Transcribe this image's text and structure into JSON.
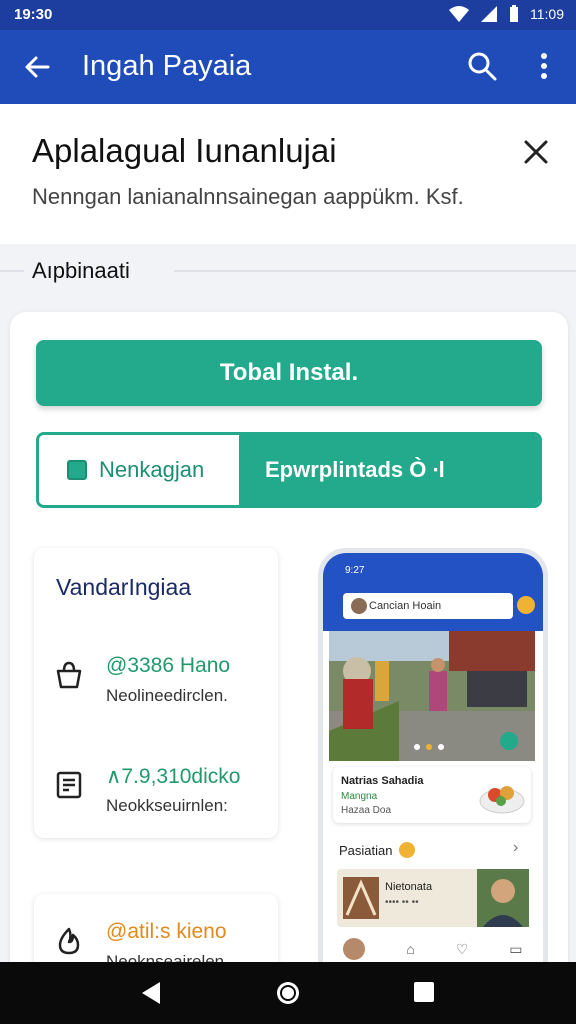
{
  "status_bar": {
    "time": "19:30",
    "right_time": "11:09"
  },
  "app_bar": {
    "title": "Ingah Payaia"
  },
  "sheet": {
    "heading": "Aplalagual Iunanlujai",
    "subtitle": "Nenngan lanianalnnsainegan aappükm. Ksf."
  },
  "section_label": "Aıpbinaati",
  "card": {
    "install_button": "Tobal Instal.",
    "segment": {
      "left_label": "Nenkagjan",
      "right_label": "Epwrplintads Ò ∙l"
    },
    "info": {
      "title": "VandarIngiaa",
      "rows": [
        {
          "icon": "bag-icon",
          "value": "@3386 Hano",
          "label": "Neolineedirclen."
        },
        {
          "icon": "receipt-icon",
          "value": "∧7.9,310dicko",
          "label": "Neokkseuirnlen:"
        }
      ]
    },
    "info2": {
      "icon": "flame-icon",
      "value": "@atil:s kieno",
      "label": "Neoknseairelen."
    }
  },
  "phone": {
    "time": "9:27",
    "search_placeholder": "Cancian Hoain",
    "dish": {
      "title": "Natrias Sahadia",
      "status": "Mangna",
      "meta": "Hazaa Doa"
    },
    "section_title": "Pasiatian",
    "tile": {
      "title": "Nietonata",
      "meta": "•••• •• ••"
    },
    "nav": [
      "⌂",
      "♡",
      "▭"
    ]
  },
  "colors": {
    "brand": "#1f4cb8",
    "accent": "#23a98b",
    "status": "#1d3e9e"
  }
}
